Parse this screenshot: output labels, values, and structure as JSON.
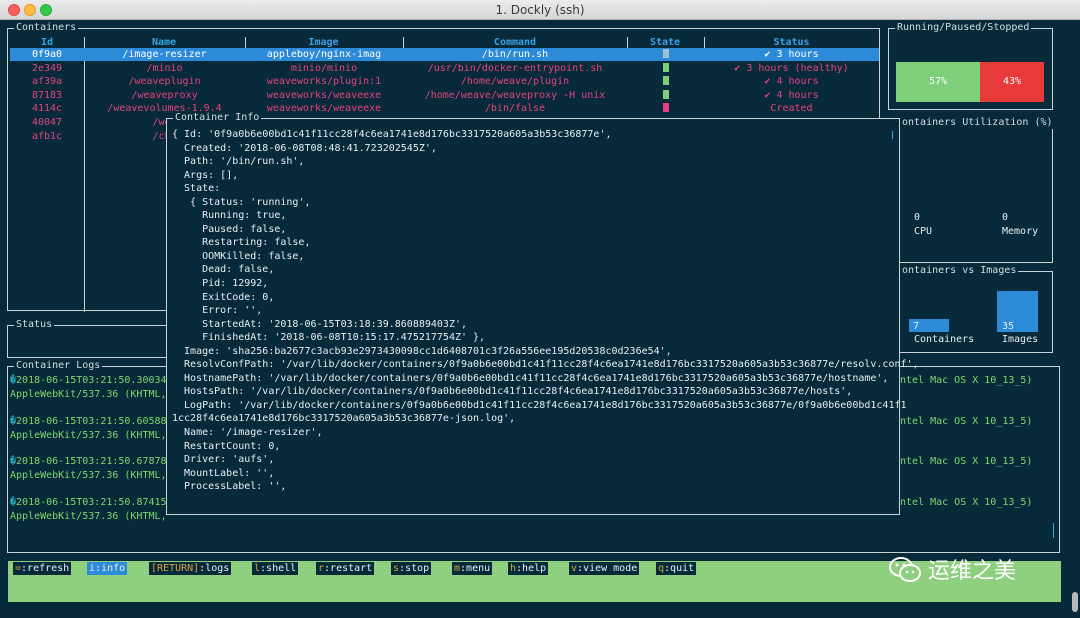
{
  "window": {
    "title": "1. Dockly (ssh)"
  },
  "panels": {
    "containers": "Containers",
    "status": "Status",
    "logs": "Container Logs",
    "running_paused_stopped": "Running/Paused/Stopped",
    "utilization": "ontainers Utilization (%)",
    "vs_images": "ontainers vs Images",
    "info": "Container Info"
  },
  "table": {
    "headers": {
      "id": "Id",
      "name": "Name",
      "image": "Image",
      "command": "Command",
      "state": "State",
      "status": "Status"
    },
    "rows": [
      {
        "id": "0f9a0",
        "name": "/image-resizer",
        "image": "appleboy/nginx-imag",
        "command": "/bin/run.sh",
        "state_color": "#9ec0cf",
        "status": "✔ 3 hours",
        "selected": true
      },
      {
        "id": "2e349",
        "name": "/minio",
        "image": "minio/minio",
        "command": "/usr/bin/docker-entrypoint.sh",
        "state_color": "#7fce7a",
        "status": "✔ 3 hours (healthy)"
      },
      {
        "id": "af39a",
        "name": "/weaveplugin",
        "image": "weaveworks/plugin:1",
        "command": "/home/weave/plugin",
        "state_color": "#7fce7a",
        "status": "✔ 4 hours"
      },
      {
        "id": "87183",
        "name": "/weaveproxy",
        "image": "weaveworks/weaveexe",
        "command": "/home/weave/weaveproxy -H unix",
        "state_color": "#7fce7a",
        "status": "✔ 4 hours"
      },
      {
        "id": "4114c",
        "name": "/weavevolumes-1.9.4",
        "image": "weaveworks/weaveexe",
        "command": "/bin/false",
        "state_color": "#e5427f",
        "status": "Created"
      },
      {
        "id": "40047",
        "name": "/wea"
      },
      {
        "id": "afb1c",
        "name": "/chr"
      }
    ]
  },
  "running_bar": {
    "running_pct": 57,
    "stopped_pct": 43,
    "running_label": "57%",
    "stopped_label": "43%"
  },
  "utilization": {
    "cpu_value": "0",
    "cpu_label": "CPU",
    "memory_value": "0",
    "memory_label": "Memory"
  },
  "vs_images": {
    "containers_value": "7",
    "containers_label": "Containers",
    "images_value": "35",
    "images_label": "Images"
  },
  "container_info_lines": [
    "{ Id: '0f9a0b6e00bd1c41f11cc28f4c6ea1741e8d176bc3317520a605a3b53c36877e',",
    "  Created: '2018-06-08T08:48:41.723202545Z',",
    "  Path: '/bin/run.sh',",
    "  Args: [],",
    "  State:",
    "   { Status: 'running',",
    "     Running: true,",
    "     Paused: false,",
    "     Restarting: false,",
    "     OOMKilled: false,",
    "     Dead: false,",
    "     Pid: 12992,",
    "     ExitCode: 0,",
    "     Error: '',",
    "     StartedAt: '2018-06-15T03:18:39.860889403Z',",
    "     FinishedAt: '2018-06-08T10:15:17.475217754Z' },",
    "  Image: 'sha256:ba2677c3acb93e2973430098cc1d6408701c3f26a556ee195d20538c0d236e54',",
    "  ResolvConfPath: '/var/lib/docker/containers/0f9a0b6e00bd1c41f11cc28f4c6ea1741e8d176bc3317520a605a3b53c36877e/resolv.conf',",
    "  HostnamePath: '/var/lib/docker/containers/0f9a0b6e00bd1c41f11cc28f4c6ea1741e8d176bc3317520a605a3b53c36877e/hostname',",
    "  HostsPath: '/var/lib/docker/containers/0f9a0b6e00bd1c41f11cc28f4c6ea1741e8d176bc3317520a605a3b53c36877e/hosts',",
    "  LogPath: '/var/lib/docker/containers/0f9a0b6e00bd1c41f11cc28f4c6ea1741e8d176bc3317520a605a3b53c36877e/0f9a0b6e00bd1c41f1",
    "1cc28f4c6ea1741e8d176bc3317520a605a3b53c36877e-json.log',",
    "  Name: '/image-resizer',",
    "  RestartCount: 0,",
    "  Driver: 'aufs',",
    "  MountLabel: '',",
    "  ProcessLabel: '',"
  ],
  "logs": [
    {
      "ts": "2018-06-15T03:21:50.30034",
      "ua": "AppleWebKit/537.36 (KHTML,",
      "tail": "ntel Mac OS X 10_13_5)"
    },
    {
      "ts": "2018-06-15T03:21:50.60588",
      "ua": "AppleWebKit/537.36 (KHTML,",
      "tail": "ntel Mac OS X 10_13_5)"
    },
    {
      "ts": "2018-06-15T03:21:50.67878",
      "ua": "AppleWebKit/537.36 (KHTML,",
      "tail": "ntel Mac OS X 10_13_5)"
    },
    {
      "ts": "2018-06-15T03:21:50.87415",
      "ua": "AppleWebKit/537.36 (KHTML,",
      "tail": "ntel Mac OS X 10_13_5)"
    }
  ],
  "log_marker": "�",
  "keys": [
    {
      "key": "=",
      "label": ":refresh"
    },
    {
      "key": "i",
      "label": ":info",
      "active": true
    },
    {
      "key": "[RETURN]",
      "label": ":logs"
    },
    {
      "key": "l",
      "label": ":shell"
    },
    {
      "key": "r",
      "label": ":restart"
    },
    {
      "key": "s",
      "label": ":stop"
    },
    {
      "key": "m",
      "label": ":menu"
    },
    {
      "key": "h",
      "label": ":help"
    },
    {
      "key": "v",
      "label": ":view mode"
    },
    {
      "key": "q",
      "label": ":quit"
    }
  ],
  "watermark": "运维之美",
  "colors": {
    "background": "#062a3a",
    "accent": "#2d8ad8",
    "running": "#7fce7a",
    "stopped": "#e83a3a",
    "row_text": "#e5427f",
    "footer": "#8ed07f"
  }
}
